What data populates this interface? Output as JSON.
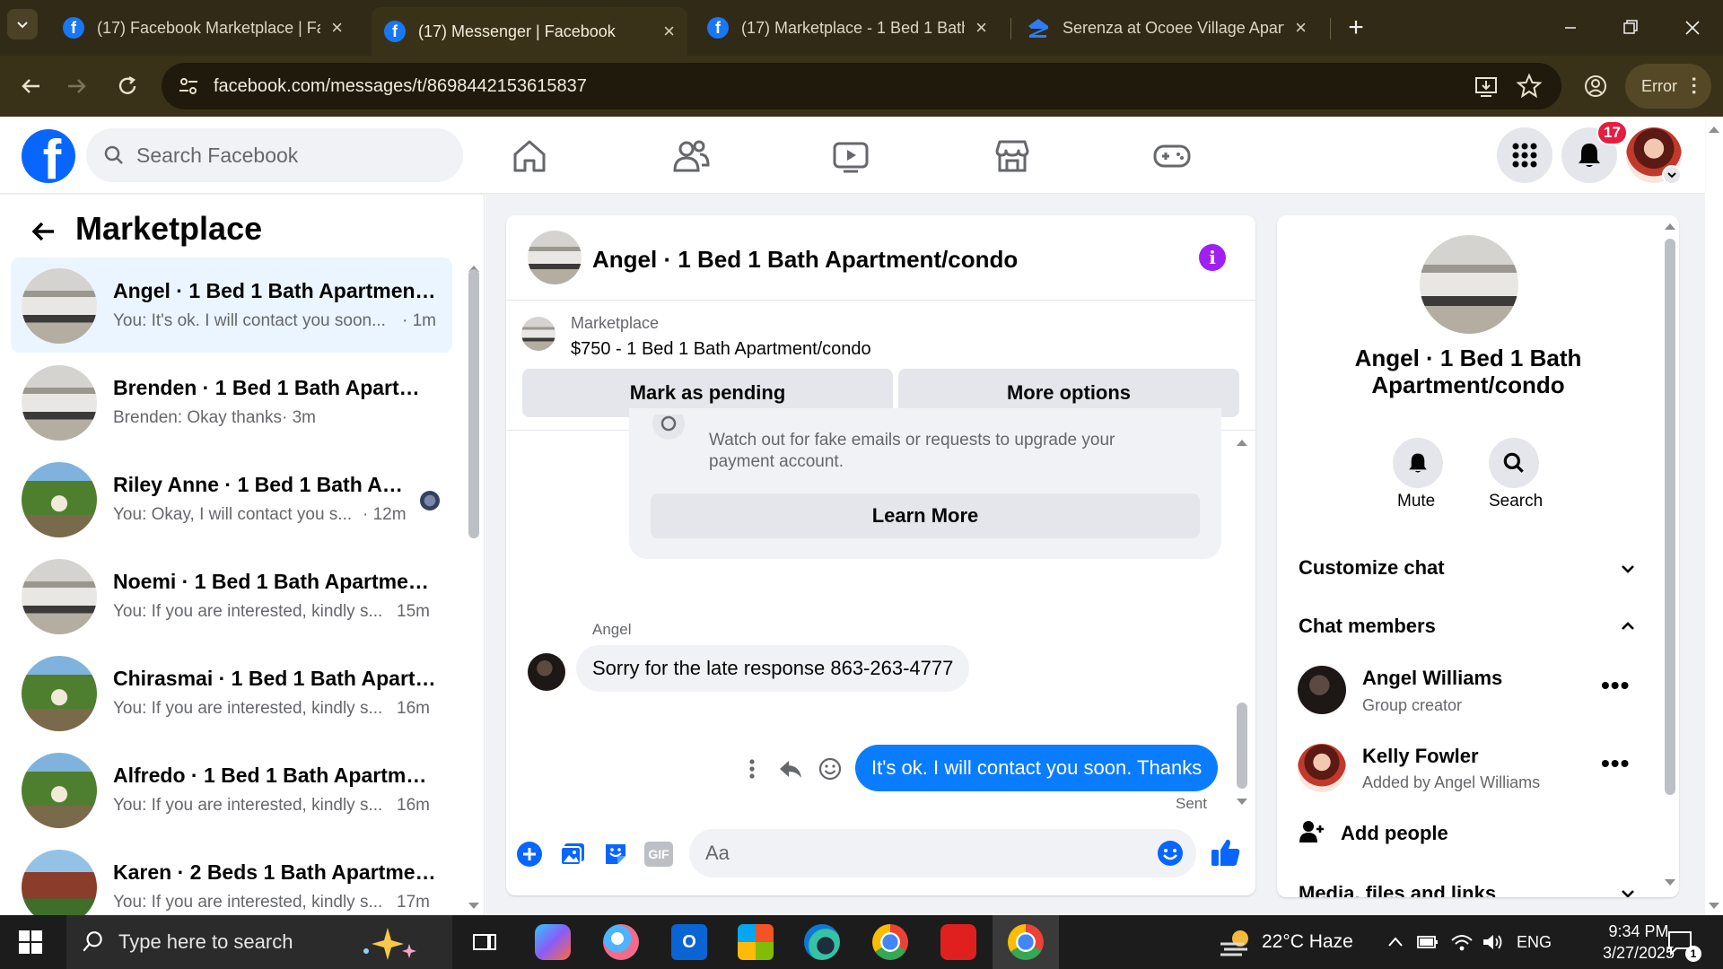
{
  "browser": {
    "tabs": [
      {
        "title": "(17) Facebook Marketplace | Fa",
        "icon": "facebook-icon"
      },
      {
        "title": "(17) Messenger | Facebook",
        "icon": "facebook-icon",
        "active": true
      },
      {
        "title": "(17) Marketplace - 1 Bed 1 Bath",
        "icon": "facebook-icon"
      },
      {
        "title": "Serenza at Ocoee Village Apart",
        "icon": "zillow-icon"
      }
    ],
    "url": "facebook.com/messages/t/8698442153615837",
    "profile_status": "Error"
  },
  "fb": {
    "search_placeholder": "Search Facebook",
    "notification_count": "17"
  },
  "sidebar": {
    "title": "Marketplace",
    "conversations": [
      {
        "name": "Angel · 1 Bed 1 Bath Apartment/...",
        "preview": "You: It's ok. I will contact you soon...",
        "time": "· 1m",
        "avatar": "room"
      },
      {
        "name": "Brenden · 1 Bed 1 Bath Apartme...",
        "preview": "Brenden: Okay thanks",
        "time": "· 3m",
        "avatar": "room"
      },
      {
        "name": "Riley Anne · 1 Bed 1 Bath Apar...",
        "preview": "You: Okay, I will contact you s...",
        "time": "· 12m",
        "avatar": "tree"
      },
      {
        "name": "Noemi · 1 Bed 1 Bath Apartment...",
        "preview": "You: If you are interested, kindly s...",
        "time": "15m",
        "avatar": "room"
      },
      {
        "name": "Chirasmai · 1 Bed 1 Bath Apartm...",
        "preview": "You: If you are interested, kindly s...",
        "time": "16m",
        "avatar": "tree"
      },
      {
        "name": "Alfredo · 1 Bed 1 Bath Apartmen...",
        "preview": "You: If you are interested, kindly s...",
        "time": "16m",
        "avatar": "tree"
      },
      {
        "name": "Karen · 2 Beds 1 Bath Apartment...",
        "preview": "You: If you are interested, kindly s...",
        "time": "17m",
        "avatar": "house"
      }
    ]
  },
  "chat": {
    "title": "Angel · 1 Bed 1 Bath Apartment/condo",
    "listing_label": "Marketplace",
    "listing_price": "$750 - 1 Bed 1 Bath Apartment/condo",
    "mark_pending": "Mark as pending",
    "more_options": "More options",
    "safety_text": "Watch out for fake emails or requests to upgrade your payment account.",
    "learn_more": "Learn More",
    "sender": "Angel",
    "incoming_message": "Sorry for the late response 863-263-4777",
    "outgoing_message": "It's ok. I will contact you soon. Thanks",
    "sent_status": "Sent",
    "composer_placeholder": "Aa"
  },
  "info_panel": {
    "name": "Angel · 1 Bed 1 Bath Apartment/condo",
    "mute": "Mute",
    "search": "Search",
    "customize_chat": "Customize chat",
    "chat_members": "Chat members",
    "members": [
      {
        "name": "Angel Williams",
        "role": "Group creator"
      },
      {
        "name": "Kelly Fowler",
        "role": "Added by Angel Williams"
      }
    ],
    "add_people": "Add people",
    "media_files": "Media, files and links"
  },
  "taskbar": {
    "search_placeholder": "Type here to search",
    "weather": "22°C  Haze",
    "language": "ENG",
    "time": "9:34 PM",
    "date": "3/27/2025",
    "notification_count": "1"
  },
  "colors": {
    "facebook_blue": "#0866ff",
    "messenger_blue": "#0a7cff",
    "selected_conv": "#ebf5ff",
    "browser_bg": "#302a16",
    "badge_red": "#e41e3f"
  }
}
